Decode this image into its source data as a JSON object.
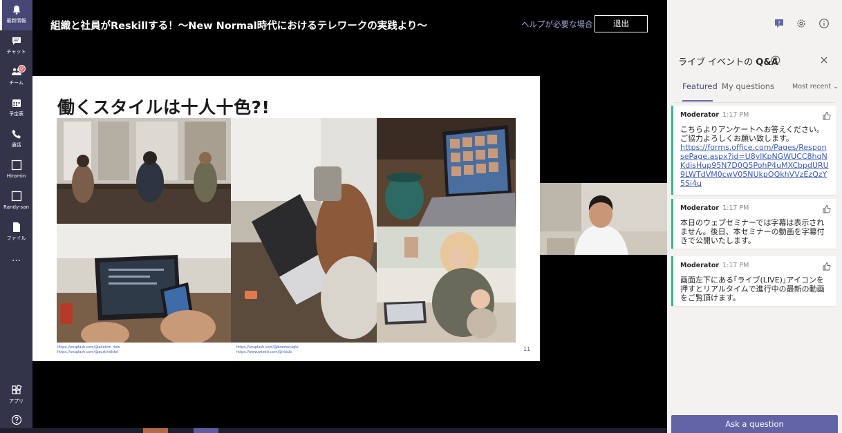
{
  "rail": {
    "items": [
      {
        "label": "最新情報",
        "icon": "bell-icon"
      },
      {
        "label": "チャット",
        "icon": "chat-icon"
      },
      {
        "label": "チーム",
        "icon": "teams-icon",
        "badge": "@"
      },
      {
        "label": "予定表",
        "icon": "calendar-icon"
      },
      {
        "label": "通話",
        "icon": "phone-icon"
      },
      {
        "label": "Hiromin",
        "icon": "app-tile-icon"
      },
      {
        "label": "Randy-san",
        "icon": "app-tile-icon"
      },
      {
        "label": "ファイル",
        "icon": "file-icon"
      },
      {
        "label": "…",
        "icon": "more-icon"
      },
      {
        "label": "アプリ",
        "icon": "apps-icon"
      },
      {
        "label": "",
        "icon": "help-icon"
      }
    ]
  },
  "header": {
    "title": "組織と社員がReskillする！〜New Normal時代におけるテレワークの実践より〜",
    "help_link": "ヘルプが必要な場合",
    "leave_label": "退出"
  },
  "slide": {
    "title": "働くスタイルは十人十色?!",
    "credits_left": [
      "https://unsplash.com/@adekim_new",
      "https://unsplash.com/@austindistel"
    ],
    "credits_right": [
      "https://unsplash.com/@brookecagle",
      "https://www.pexels.com/@vlada"
    ],
    "page_number": "11"
  },
  "qa": {
    "title_prefix": "ライブ イベントの ",
    "title_bold": "Q&A",
    "tabs": [
      {
        "label": "Featured"
      },
      {
        "label": "My questions"
      }
    ],
    "sort_label": "Most recent ⌄",
    "cards": [
      {
        "author": "Moderator",
        "time": "1:17 PM",
        "text": "こちらよりアンケートへお答えください。ご協力よろしくお願い致します。",
        "link": "https://forms.office.com/Pages/ResponsePage.aspx?id=U8ylKpNGWUCC8hqNKdisHup95N7D0Q5PohP4uMXCbpdURU9LWTdVM0cwV05NUkpOQkhVVzEzQzY5Si4u"
      },
      {
        "author": "Moderator",
        "time": "1:17 PM",
        "text": "本日のウェブセミナーでは字幕は表示されません。後日、本セミナーの動画を字幕付きで公開いたします。"
      },
      {
        "author": "Moderator",
        "time": "1:17 PM",
        "text": "画面左下にある｢ライブ(LIVE)｣アイコンを押すとリアルタイムで進行中の最新の動画をご覧頂けます。"
      }
    ],
    "ask_label": "Ask a question"
  },
  "colors": {
    "rail": "#33344a",
    "accent": "#6264a7",
    "featured_border": "#37b589"
  }
}
